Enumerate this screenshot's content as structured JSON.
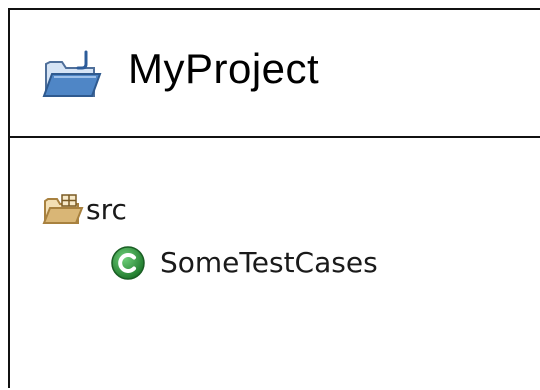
{
  "header": {
    "title": "MyProject",
    "icon": "java-project-folder-icon"
  },
  "tree": {
    "items": [
      {
        "label": "src",
        "icon": "source-package-folder-icon"
      },
      {
        "label": "SomeTestCases",
        "icon": "java-class-icon"
      }
    ]
  },
  "colors": {
    "folder_tan": "#d9b676",
    "folder_blue": "#4f86c6",
    "class_green": "#2f9a3c",
    "border": "#111111"
  }
}
